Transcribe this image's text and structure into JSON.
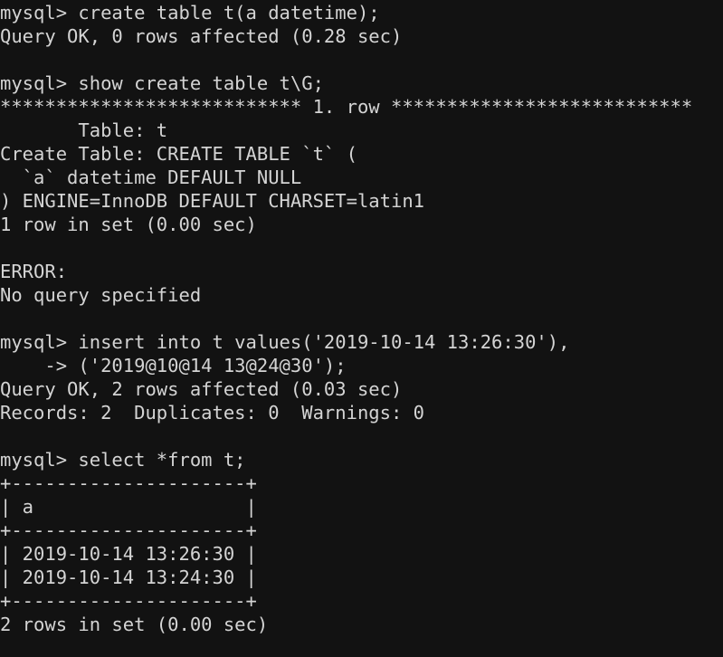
{
  "terminal": {
    "colors": {
      "background": "#121212",
      "foreground": "#d4d4d4"
    },
    "prompt": "mysql>",
    "continuation_prompt": "    ->",
    "lines": [
      "mysql> create table t(a datetime);",
      "Query OK, 0 rows affected (0.28 sec)",
      "",
      "mysql> show create table t\\G;",
      "*************************** 1. row ***************************",
      "       Table: t",
      "Create Table: CREATE TABLE `t` (",
      "  `a` datetime DEFAULT NULL",
      ") ENGINE=InnoDB DEFAULT CHARSET=latin1",
      "1 row in set (0.00 sec)",
      "",
      "ERROR:",
      "No query specified",
      "",
      "mysql> insert into t values('2019-10-14 13:26:30'),",
      "    -> ('2019@10@14 13@24@30');",
      "Query OK, 2 rows affected (0.03 sec)",
      "Records: 2  Duplicates: 0  Warnings: 0",
      "",
      "mysql> select *from t;",
      "+---------------------+",
      "| a                   |",
      "+---------------------+",
      "| 2019-10-14 13:26:30 |",
      "| 2019-10-14 13:24:30 |",
      "+---------------------+",
      "2 rows in set (0.00 sec)"
    ]
  }
}
